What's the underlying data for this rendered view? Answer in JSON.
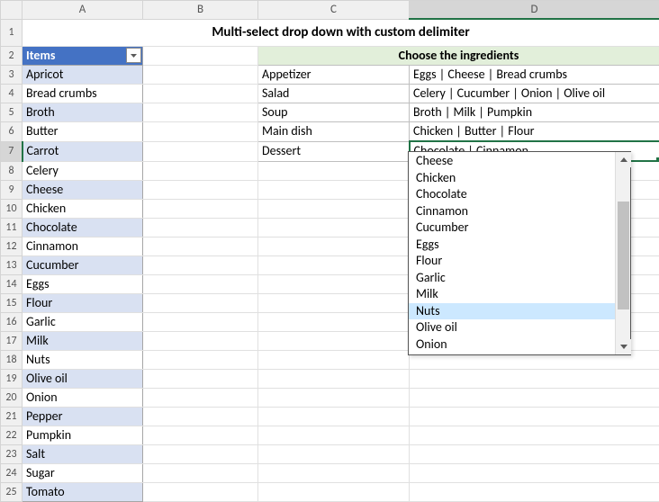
{
  "title": "Multi-select drop down with custom delimiter",
  "headers": {
    "items": "Items",
    "ingredients": "Choose the ingredients"
  },
  "columns": [
    "A",
    "B",
    "C",
    "D"
  ],
  "rows_visible": [
    1,
    2,
    3,
    4,
    5,
    6,
    7,
    8,
    9,
    10,
    11,
    12,
    13,
    14,
    15,
    16,
    17,
    18,
    19,
    20,
    21,
    22,
    23,
    24,
    25
  ],
  "items": [
    "Apricot",
    "Bread crumbs",
    "Broth",
    "Butter",
    "Carrot",
    "Celery",
    "Cheese",
    "Chicken",
    "Chocolate",
    "Cinnamon",
    "Cucumber",
    "Eggs",
    "Flour",
    "Garlic",
    "Milk",
    "Nuts",
    "Olive oil",
    "Onion",
    "Pepper",
    "Pumpkin",
    "Salt",
    "Sugar",
    "Tomato"
  ],
  "courses": [
    {
      "name": "Appetizer",
      "selection": "Eggs | Cheese | Bread crumbs"
    },
    {
      "name": "Salad",
      "selection": "Celery | Cucumber | Onion | Olive oil"
    },
    {
      "name": "Soup",
      "selection": "Broth | Milk | Pumpkin"
    },
    {
      "name": "Main dish",
      "selection": "Chicken | Butter | Flour"
    },
    {
      "name": "Dessert",
      "selection": "Chocolate | Cinnamon"
    }
  ],
  "active_cell": "D7",
  "dropdown": {
    "options": [
      "Cheese",
      "Chicken",
      "Chocolate",
      "Cinnamon",
      "Cucumber",
      "Eggs",
      "Flour",
      "Garlic",
      "Milk",
      "Nuts",
      "Olive oil",
      "Onion"
    ],
    "highlighted_index": 9
  }
}
